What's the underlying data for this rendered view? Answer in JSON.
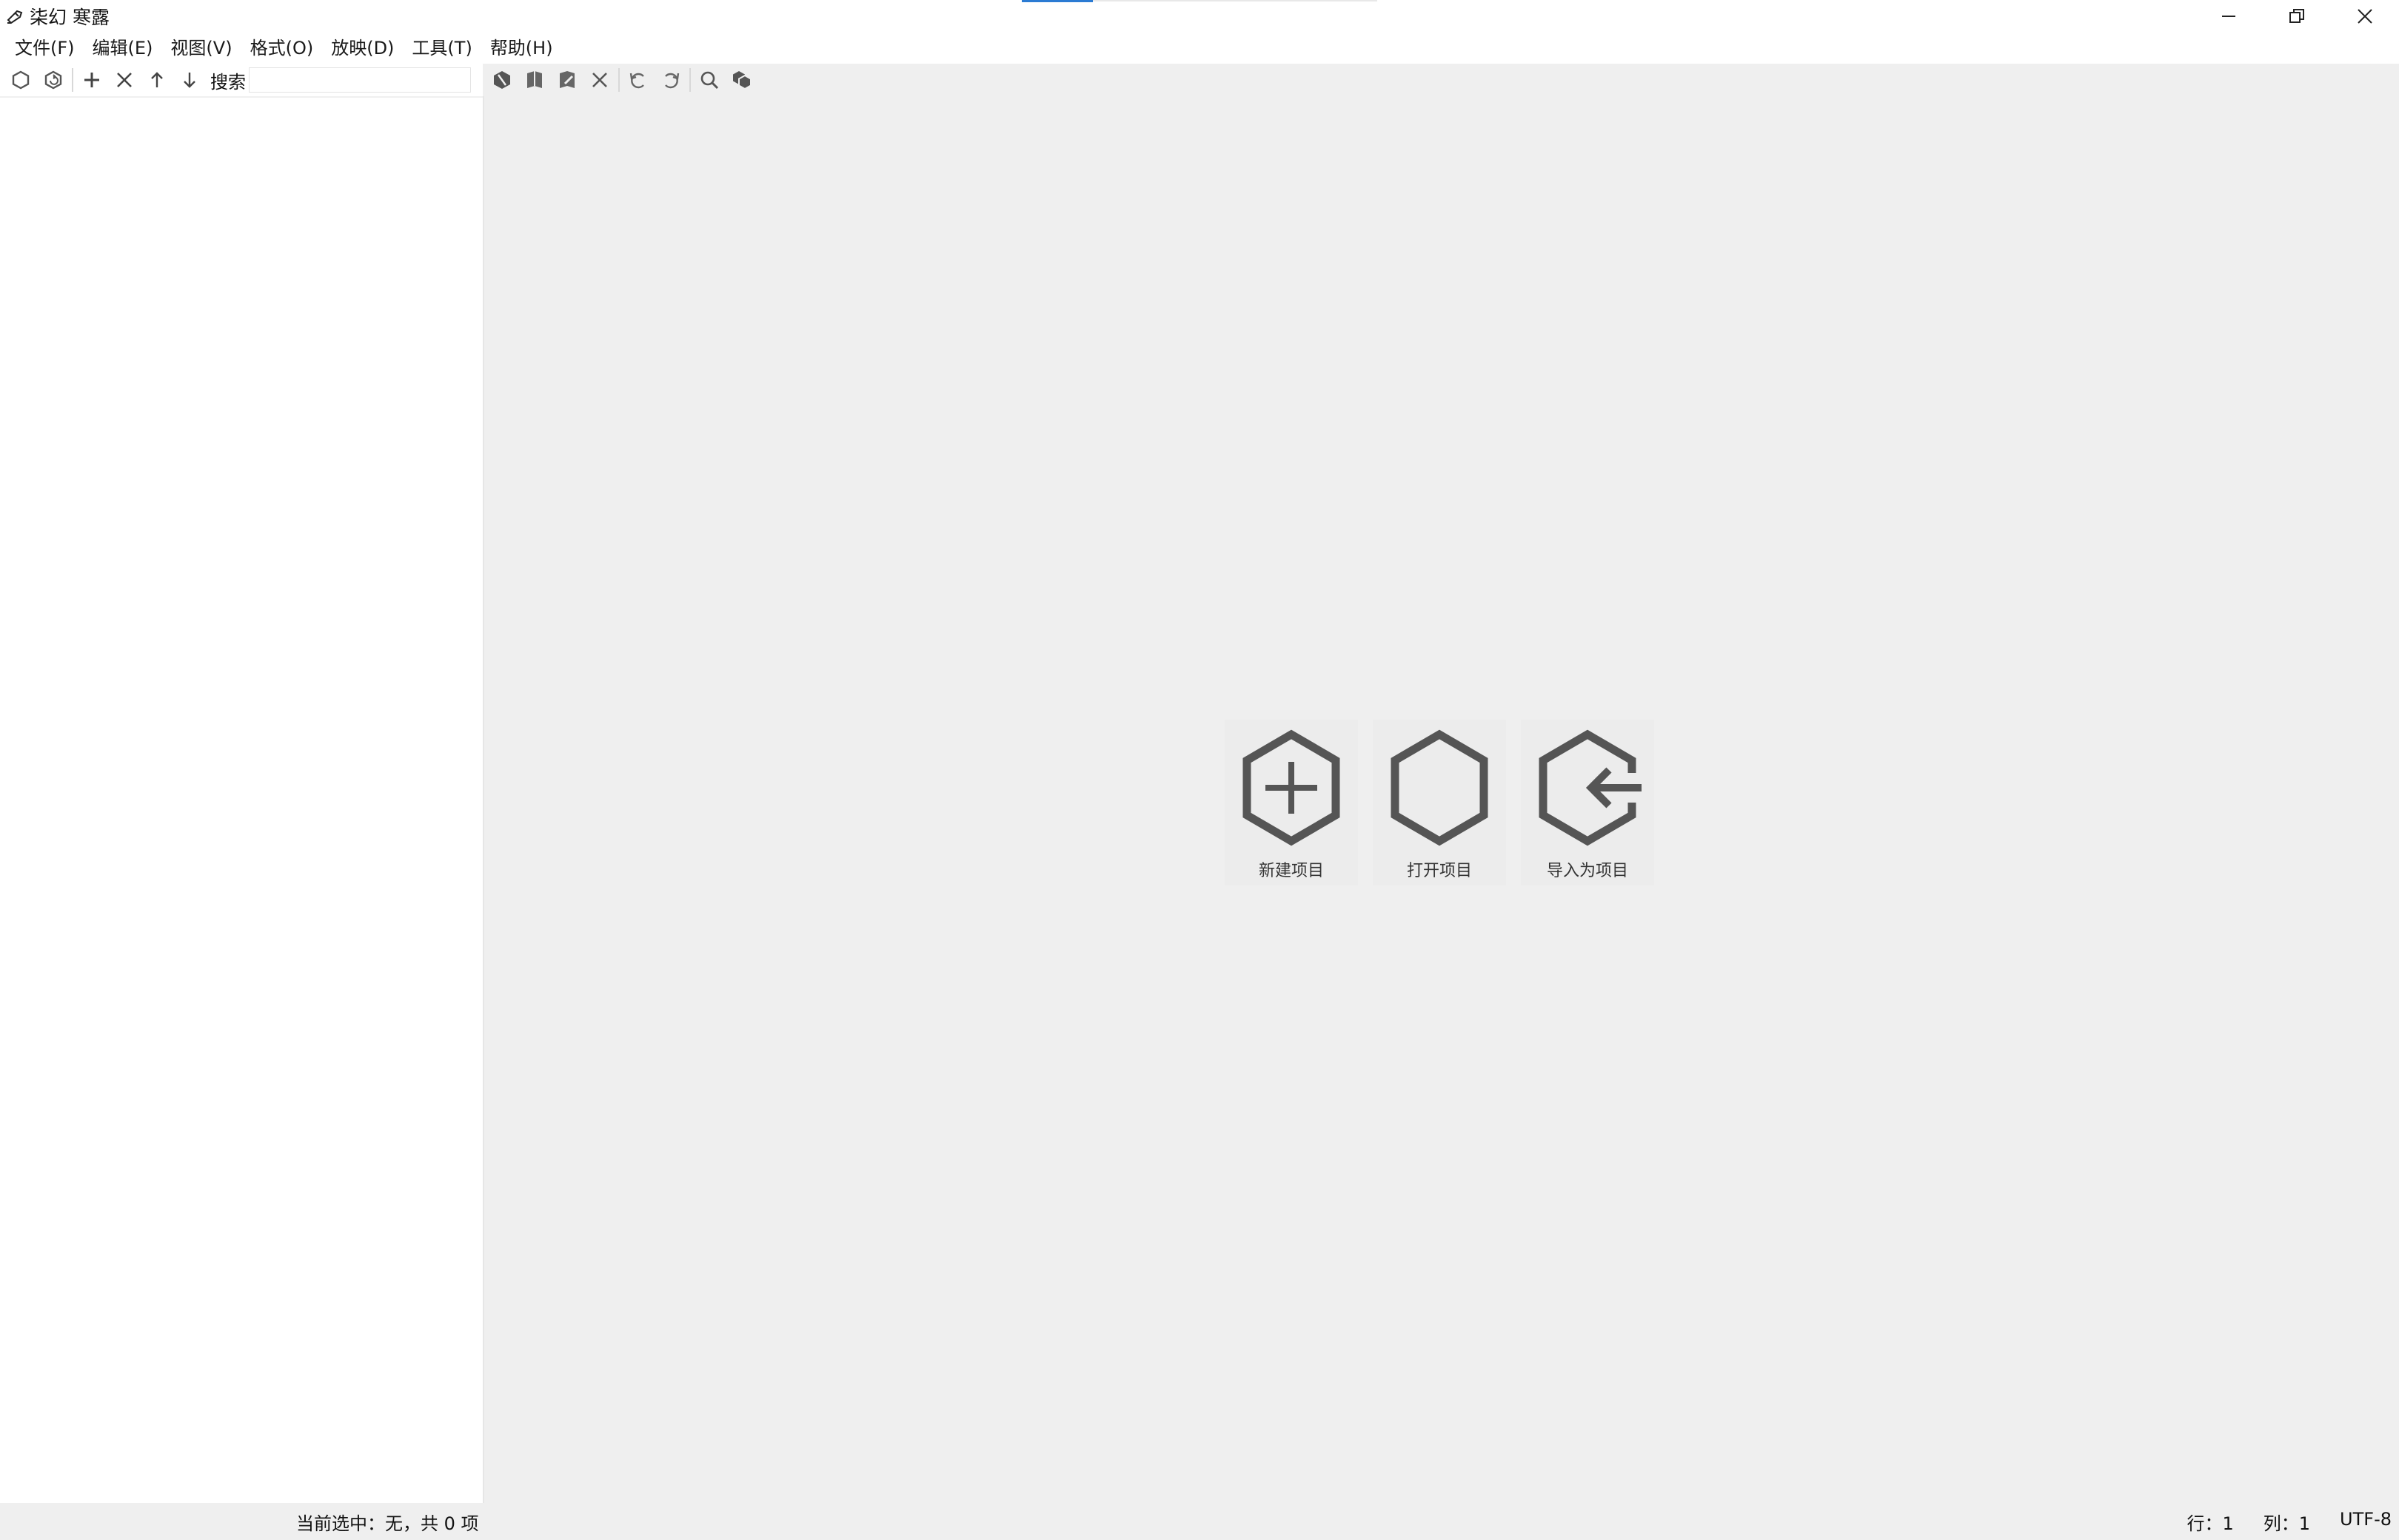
{
  "window": {
    "title": "柒幻 寒露",
    "controls": {
      "minimize": "minimize-icon",
      "maximize": "restore-icon",
      "close": "close-icon"
    }
  },
  "menu": {
    "items": [
      {
        "label": "文件(F)"
      },
      {
        "label": "编辑(E)"
      },
      {
        "label": "视图(V)"
      },
      {
        "label": "格式(O)"
      },
      {
        "label": "放映(D)"
      },
      {
        "label": "工具(T)"
      },
      {
        "label": "帮助(H)"
      }
    ]
  },
  "left_toolbar": {
    "icons": [
      "hexagon-icon",
      "hexagon-refresh-icon",
      "add-icon",
      "delete-icon",
      "move-up-icon",
      "move-down-icon"
    ],
    "search_label": "搜索",
    "search_value": ""
  },
  "right_toolbar": {
    "icons": [
      "render-icon",
      "book-icon",
      "book-edit-icon",
      "close-document-icon",
      "undo-icon",
      "redo-icon",
      "search-icon",
      "hexagons-icon"
    ]
  },
  "welcome": {
    "items": [
      {
        "label": "新建项目",
        "icon": "new-project-icon"
      },
      {
        "label": "打开项目",
        "icon": "open-project-icon"
      },
      {
        "label": "导入为项目",
        "icon": "import-project-icon"
      }
    ]
  },
  "status": {
    "selection": "当前选中：无，共 0 项",
    "row": "行：1",
    "col": "列：1",
    "encoding": "UTF-8"
  },
  "colors": {
    "accent": "#2b7bd3",
    "icon": "#555555",
    "main_bg": "#efefef"
  }
}
